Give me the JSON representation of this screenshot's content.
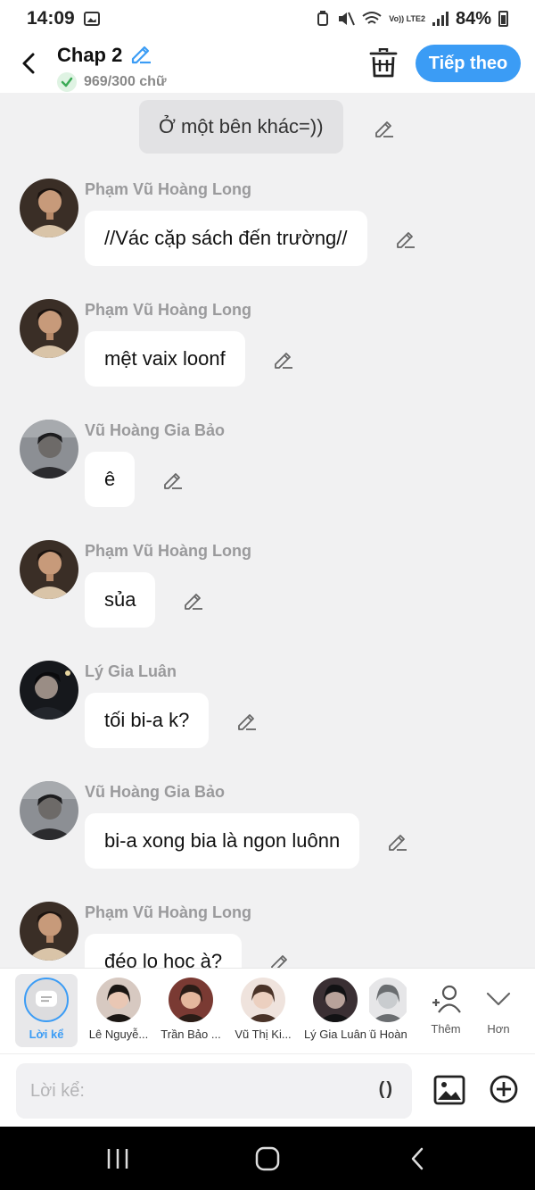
{
  "status_bar": {
    "time": "14:09",
    "network_label": "Vo)) LTE2",
    "battery": "84%"
  },
  "header": {
    "title": "Chap 2",
    "word_count": "969/300 chữ",
    "next_label": "Tiếp theo"
  },
  "chat": {
    "narration": "Ở một bên khác=))",
    "messages": [
      {
        "name": "Phạm Vũ Hoàng Long",
        "text": "//Vác cặp sách đến trường//",
        "avatar": "long"
      },
      {
        "name": "Phạm Vũ Hoàng Long",
        "text": "mệt vaix loonf",
        "avatar": "long"
      },
      {
        "name": "Vũ Hoàng Gia Bảo",
        "text": "ê",
        "avatar": "bao"
      },
      {
        "name": "Phạm Vũ Hoàng Long",
        "text": "sủa",
        "avatar": "long"
      },
      {
        "name": "Lý Gia Luân",
        "text": "tối bi-a k?",
        "avatar": "luan"
      },
      {
        "name": "Vũ Hoàng Gia Bảo",
        "text": "bi-a xong bia là ngon luônn",
        "avatar": "bao"
      },
      {
        "name": "Phạm Vũ Hoàng Long",
        "text": "đéo lo học à?",
        "avatar": "long"
      }
    ]
  },
  "character_bar": {
    "narration_label": "Lời kể",
    "characters": [
      {
        "label": "Lê Nguyễ..."
      },
      {
        "label": "Trần Bảo ..."
      },
      {
        "label": "Vũ Thị Ki..."
      },
      {
        "label": "Lý Gia Luân"
      },
      {
        "label": "Vũ Hoàng"
      }
    ],
    "add_label": "Thêm",
    "more_label": "Hơn"
  },
  "input": {
    "placeholder": "Lời kể:",
    "paren_label": "()"
  },
  "icons": {
    "back": "chevron-left-icon",
    "edit": "pencil-icon",
    "trash": "trash-icon",
    "check": "check-icon",
    "image": "image-icon",
    "add": "plus-circle-icon"
  },
  "colors": {
    "accent": "#3b9cf5",
    "background": "#f1f1f2",
    "bubble": "#ffffff",
    "narration_bubble": "#e2e2e4"
  }
}
